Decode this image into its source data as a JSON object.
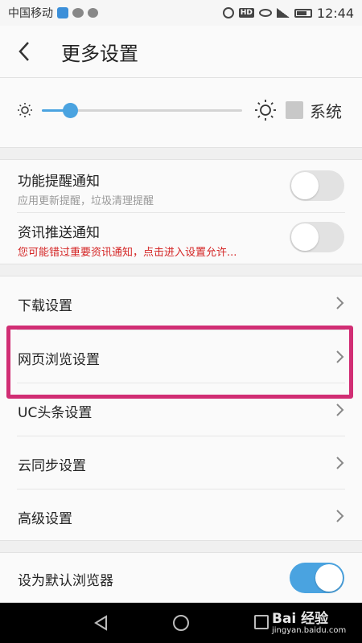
{
  "status_bar": {
    "carrier": "中国移动",
    "hd_badge": "HD",
    "time": "12:44",
    "icons": [
      "shield-icon",
      "wechat-icon",
      "message-icon",
      "alarm-icon",
      "eye-icon",
      "signal-icon",
      "battery-icon"
    ]
  },
  "header": {
    "title": "更多设置",
    "back_icon": "chevron-left-icon"
  },
  "brightness": {
    "level": 0.14,
    "system_label": "系统",
    "system_checked": false,
    "accent_color": "#4aa3e0"
  },
  "notifications": [
    {
      "title": "功能提醒通知",
      "subtitle": "应用更新提醒，垃圾清理提醒",
      "subtitle_warning": false,
      "enabled": false
    },
    {
      "title": "资讯推送通知",
      "subtitle": "您可能错过重要资讯通知，点击进入设置允许...",
      "subtitle_warning": true,
      "enabled": false
    }
  ],
  "settings_menu": [
    {
      "label": "下载设置"
    },
    {
      "label": "网页浏览设置",
      "highlighted": true
    },
    {
      "label": "UC头条设置"
    },
    {
      "label": "云同步设置"
    },
    {
      "label": "高级设置"
    }
  ],
  "default_browser": {
    "label": "设为默认浏览器",
    "enabled": true
  },
  "colors": {
    "highlight_border": "#d12e74",
    "warning_text": "#d42424",
    "toggle_on": "#4aa3e0"
  },
  "watermark": {
    "brand": "Bai 经验",
    "url": "jingyan.baidu.com"
  }
}
